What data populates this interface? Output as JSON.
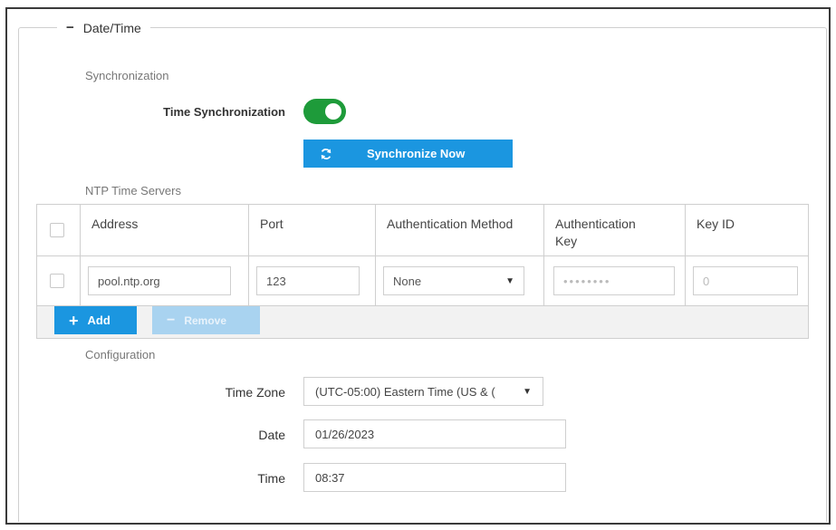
{
  "section": {
    "title": "Date/Time",
    "collapse_symbol": "−"
  },
  "synchronization": {
    "heading": "Synchronization",
    "toggle_label": "Time Synchronization",
    "toggle_on": true,
    "sync_button_label": "Synchronize Now"
  },
  "ntp": {
    "heading": "NTP Time Servers",
    "columns": [
      "Address",
      "Port",
      "Authentication Method",
      "Authentication Key",
      "Key ID"
    ],
    "rows": [
      {
        "address": "pool.ntp.org",
        "port": "123",
        "auth_method": "None",
        "auth_key": "••••••••",
        "key_id": "0"
      }
    ],
    "add_label": "Add",
    "remove_label": "Remove"
  },
  "configuration": {
    "heading": "Configuration",
    "time_zone_label": "Time Zone",
    "time_zone_value": "(UTC-05:00) Eastern Time (US & (",
    "date_label": "Date",
    "date_value": "01/26/2023",
    "time_label": "Time",
    "time_value": "08:37"
  },
  "colors": {
    "accent": "#1b96e0",
    "toggle_on": "#1e9b3a",
    "remove_disabled": "#a9d3f0"
  }
}
